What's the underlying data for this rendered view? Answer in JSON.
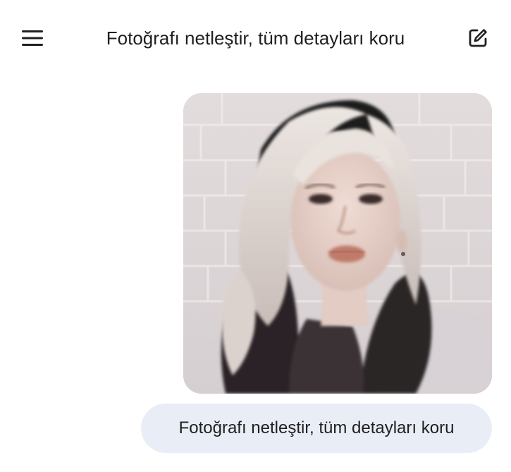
{
  "header": {
    "title": "Fotoğrafı netleştir, tüm detayları koru",
    "menu_icon": "hamburger-menu-icon",
    "new_chat_icon": "edit-square-icon"
  },
  "conversation": {
    "user_image": {
      "icon": "portrait-photo"
    },
    "user_message": "Fotoğrafı netleştir, tüm detayları koru"
  },
  "colors": {
    "background": "#ffffff",
    "text": "#1f1f1f",
    "bubble_background": "#e9eef6"
  }
}
